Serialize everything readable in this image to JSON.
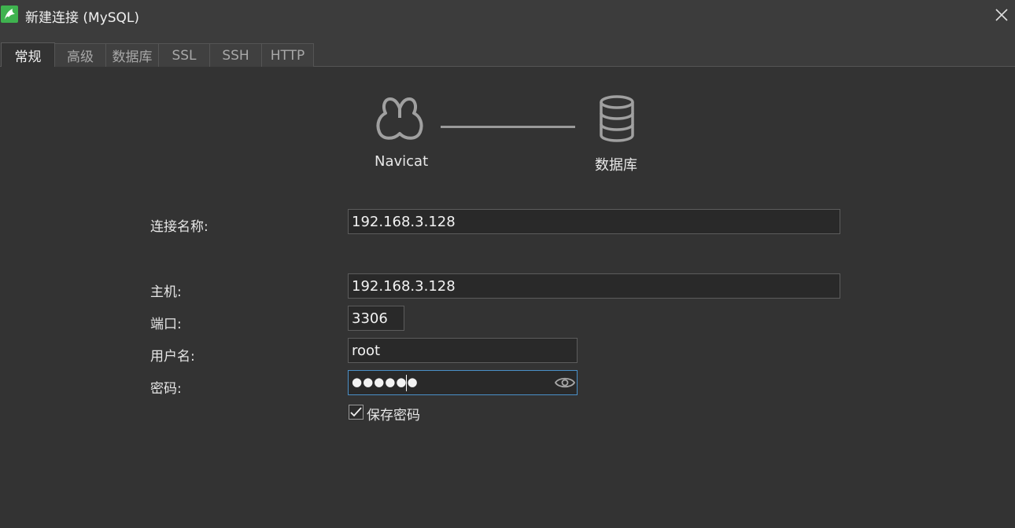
{
  "window": {
    "title": "新建连接 (MySQL)",
    "app_icon": "navicat-dolphin-icon",
    "close_icon": "close-icon"
  },
  "tabs": [
    {
      "label": "常规",
      "active": true
    },
    {
      "label": "高级",
      "active": false
    },
    {
      "label": "数据库",
      "active": false
    },
    {
      "label": "SSL",
      "active": false
    },
    {
      "label": "SSH",
      "active": false
    },
    {
      "label": "HTTP",
      "active": false
    }
  ],
  "diagram": {
    "source_label": "Navicat",
    "source_icon": "navicat-logo-icon",
    "target_label": "数据库",
    "target_icon": "database-icon"
  },
  "form": {
    "connection_name": {
      "label": "连接名称:",
      "value": "192.168.3.128"
    },
    "host": {
      "label": "主机:",
      "value": "192.168.3.128"
    },
    "port": {
      "label": "端口:",
      "value": "3306"
    },
    "username": {
      "label": "用户名:",
      "value": "root"
    },
    "password": {
      "label": "密码:",
      "masked_value": "●●●●●●",
      "reveal_icon": "eye-icon"
    },
    "save_password": {
      "label": "保存密码",
      "checked": true
    }
  },
  "colors": {
    "background": "#333333",
    "titlebar": "#3c3c3c",
    "focus_border": "#4a90c8",
    "app_icon_green": "#3fb34f"
  }
}
